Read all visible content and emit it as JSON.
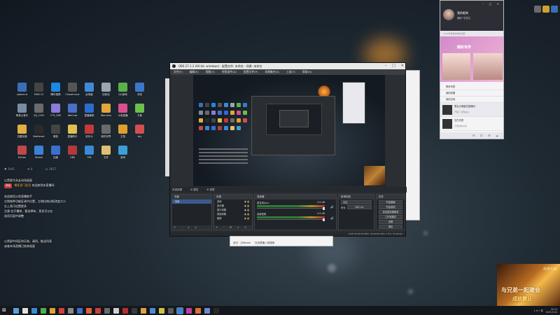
{
  "desktop": {
    "icons": [
      {
        "label": "xplorer-b",
        "color": "#3a6fb5"
      },
      {
        "label": "MSN 12",
        "color": "#444"
      },
      {
        "label": "腾讯视频",
        "color": "#1e88e5"
      },
      {
        "label": "Cloudmusic",
        "color": "#555"
      },
      {
        "label": "此电脑",
        "color": "#3f8ad8"
      },
      {
        "label": "回收站",
        "color": "#9aa6b0"
      },
      {
        "label": "QQ游戏",
        "color": "#5bb04a"
      },
      {
        "label": "浏览",
        "color": "#3c78c8"
      },
      {
        "label": "网易云音乐",
        "color": "#7a8ca0"
      },
      {
        "label": "QQ_GOO",
        "color": "#6a6a6a"
      },
      {
        "label": "CTX_EXE",
        "color": "#8a7cd8"
      },
      {
        "label": "WeChat",
        "color": "#4a6fc8"
      },
      {
        "label": "直播管家",
        "color": "#2e6bd0"
      },
      {
        "label": "Wonders",
        "color": "#e2a63a"
      },
      {
        "label": "斗鱼直播",
        "color": "#d9508f"
      },
      {
        "label": "万象",
        "color": "#6bbf4a"
      },
      {
        "label": "迅雷加速",
        "color": "#e0b040"
      },
      {
        "label": "Battlenet",
        "color": "#2a2a2a"
      },
      {
        "label": "微信",
        "color": "#444"
      },
      {
        "label": "直播助手",
        "color": "#e0c050"
      },
      {
        "label": "欢乐斗",
        "color": "#c23a3a"
      },
      {
        "label": "我的世界",
        "color": "#6a6a6a"
      },
      {
        "label": "文档",
        "color": "#e0a030"
      },
      {
        "label": "sky",
        "color": "#d05050"
      },
      {
        "label": "KuGou",
        "color": "#c04848"
      },
      {
        "label": "Steam",
        "color": "#3a82d8"
      },
      {
        "label": "加速",
        "color": "#3a6fd0"
      },
      {
        "label": "OBS",
        "color": "#b33a3a"
      },
      {
        "label": "TIM",
        "color": "#3a8ad8"
      },
      {
        "label": "文件",
        "color": "#e0c070"
      },
      {
        "label": "游戏",
        "color": "#3aa0d8"
      }
    ]
  },
  "left_info": {
    "stats": [
      "♥ 2441",
      "⚙ 0",
      "☺ 3817"
    ],
    "notice": "以黑屏冷永友动场画面",
    "badge": "弹幕",
    "danmaku": "播客直门配音",
    "danmaku_tail": "欢迎来到本直播间",
    "lines": [
      "欢迎使用斗鱼直播助手",
      "左侧各种功能区调节位置，左侧拉伸边框改变大小",
      "右上角可设置更多",
      "注意:在开播前，要选择有，您也可以在",
      "选项页面中调整"
    ],
    "footer1": "以黑屏中间区的乐和，请用，推送列表",
    "footer2": "或者本场直播已结束画面"
  },
  "obs": {
    "title": "OBS 27.1.3 (64 bit, windows) - 配置文件: 未命名 - 场景: 未命名",
    "menu": [
      "文件(F)",
      "编辑(E)",
      "视图(V)",
      "停靠部件(D)",
      "配置文件(P)",
      "场景集合(S)",
      "工具(T)",
      "帮助(H)"
    ],
    "dock_tabs": [
      "未选择源",
      "⚙ 属性",
      "⚙ 滤镜"
    ],
    "scenes_header": "场景",
    "scenes": [
      "场景"
    ],
    "sources_header": "来源",
    "sources": [
      "游戏",
      "显示器",
      "窗口采集",
      "视频采集",
      "图像"
    ],
    "mixer_header": "混音器",
    "mixer": [
      {
        "name": "麦克风/Aux",
        "db": "0.0 dB"
      },
      {
        "name": "桌面音频",
        "db": "0.0 dB"
      }
    ],
    "transitions_header": "转场特效",
    "transition_type": "淡出",
    "duration_label": "时长",
    "duration": "300 ms",
    "controls_header": "控件",
    "controls": [
      "开始直播",
      "开始录制",
      "启动虚拟摄像机",
      "工作室模式",
      "设置",
      "退出"
    ],
    "status": "LIVE: 00:00:00   REC: 00:00:00   CPU: 2.5%, 30.00 fps"
  },
  "mini_dialog": {
    "title": "",
    "items": [
      "武汉 · 汉Steam",
      "在这里输入来搜索"
    ]
  },
  "chat_app": {
    "user_name": "我的昵称",
    "signature": "编辑个性签名",
    "search": "2020年度我的精彩回顾",
    "banner_title": "精彩世界",
    "items": [
      {
        "title": "联系列表"
      },
      {
        "title": "我的收藏"
      },
      {
        "title": "我的空间"
      },
      {
        "title": "联合大明星的直播间",
        "sub": "开播了·赶快进入"
      },
      {
        "title": "空白列表",
        "sub": "已添加的好友"
      }
    ]
  },
  "game_ad": {
    "line1": "与兄弟一起建会",
    "line2": "成就霸业",
    "tag": "传奇归来"
  },
  "taskbar": {
    "start": "⊞",
    "icons": [
      "#5aa0e0",
      "#e0e0e0",
      "#3a8ad8",
      "#4ab04a",
      "#e0a030",
      "#d04040",
      "#888",
      "#3a6fd0",
      "#e06040",
      "#c84040",
      "#6a6a6a",
      "#d0d0d0",
      "#b03030",
      "#3a3a3a",
      "#e0a040",
      "#4a8ad0",
      "#d0c040",
      "#5a5a5a",
      "#3a82d8",
      "#c040a0",
      "#e07030",
      "#6a8ad0",
      "#2a2a2a"
    ],
    "active_index": 18,
    "tray": "∧  ✉  ♪  英",
    "time": "20:14",
    "date": "2021/1/14"
  }
}
